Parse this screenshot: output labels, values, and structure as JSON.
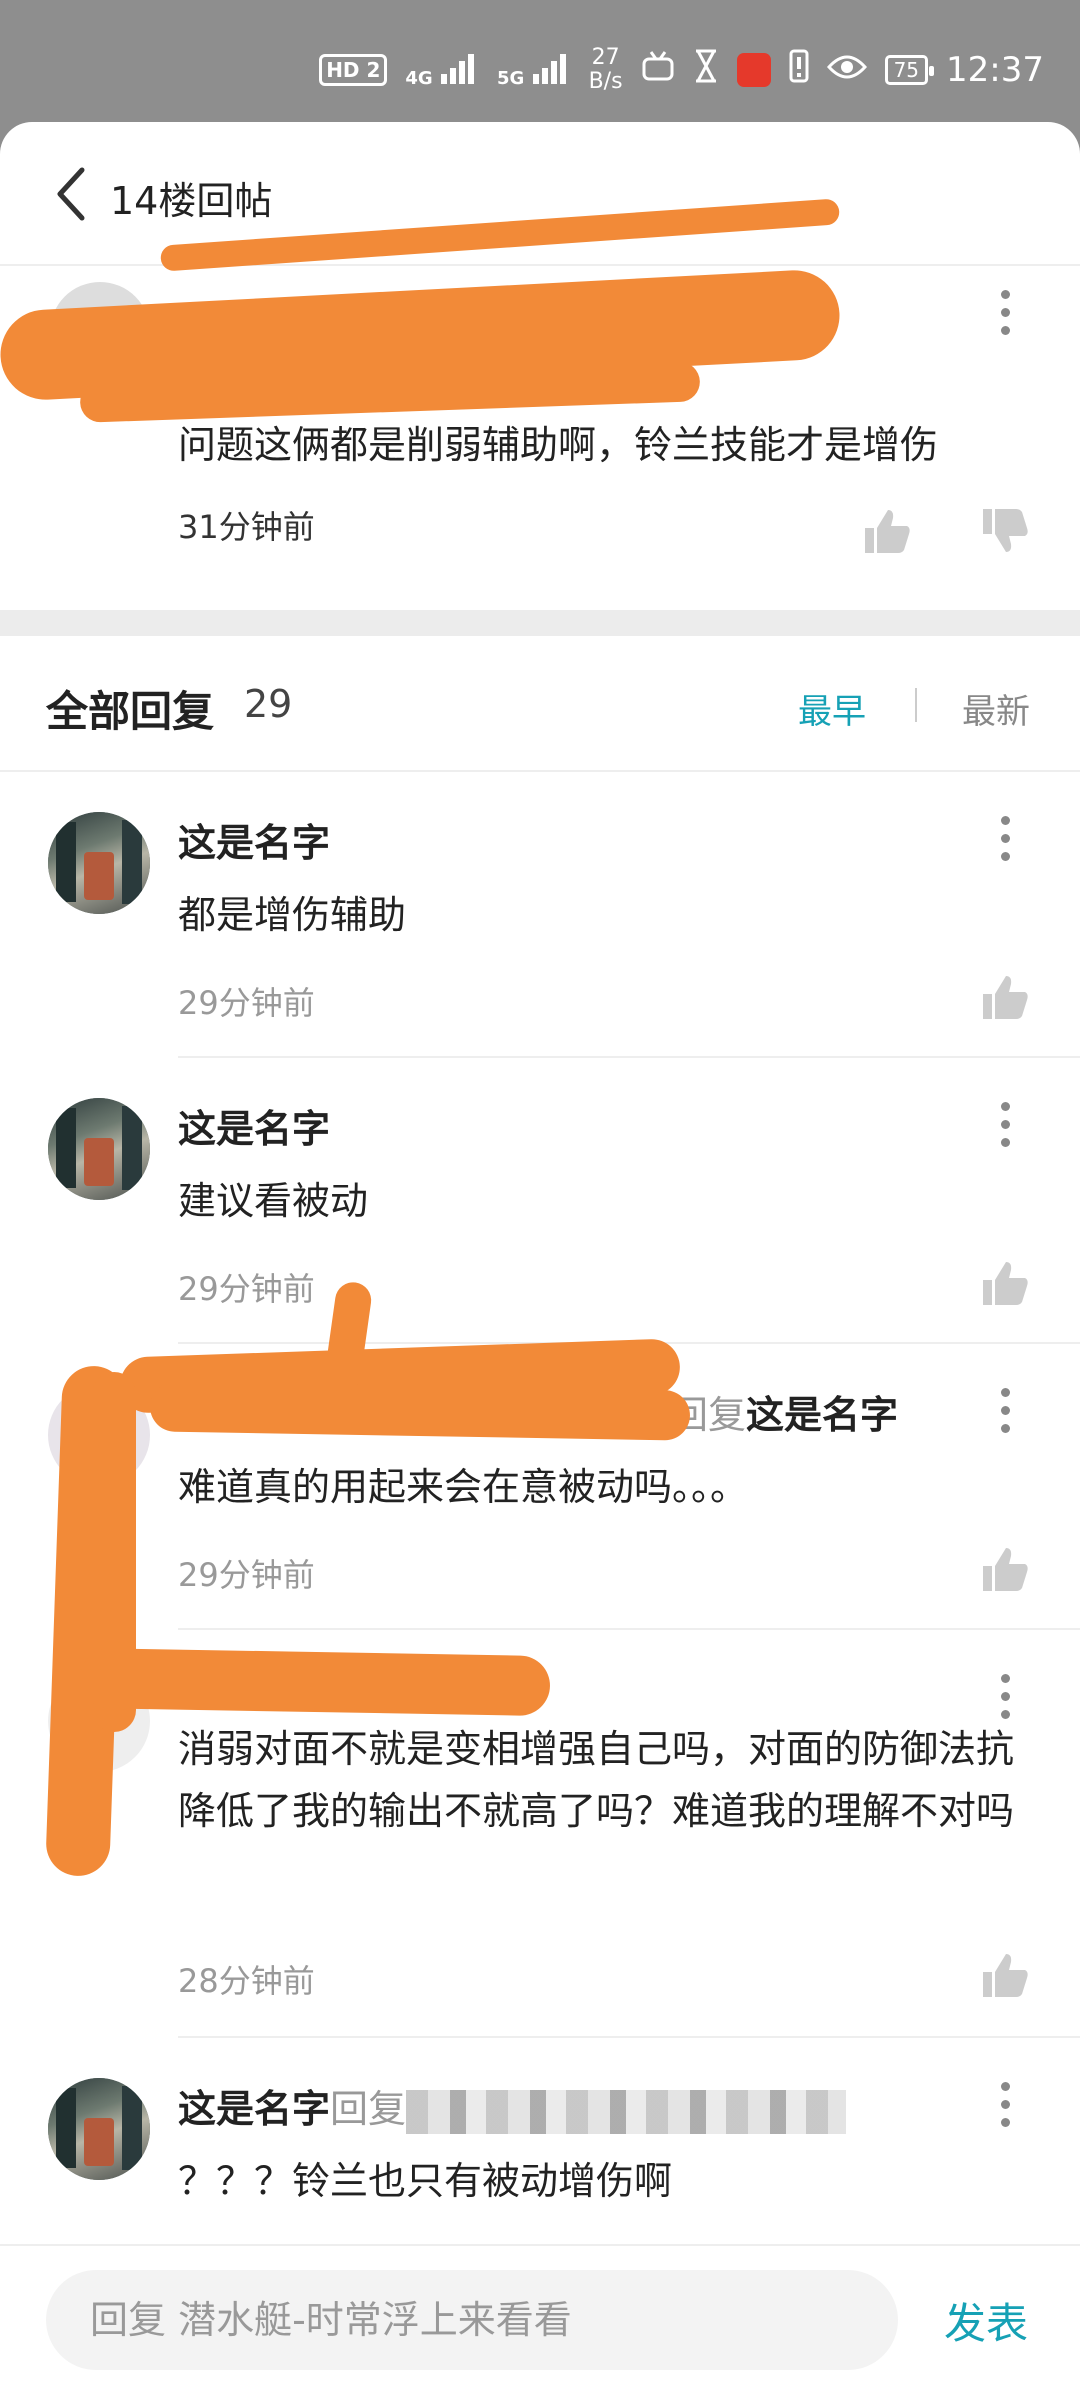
{
  "statusbar": {
    "network_hd": "HD 2",
    "net1": "4G",
    "net2": "5G",
    "speed_value": "27",
    "speed_unit": "B/s",
    "battery": "75",
    "time": "12:37",
    "icons": [
      "hd-icon",
      "signal-4g-icon",
      "signal-5g-icon",
      "tv-icon",
      "hourglass-icon",
      "app-notification-icon",
      "alert-icon",
      "eye-icon",
      "battery-icon"
    ]
  },
  "header": {
    "title": "14楼回帖"
  },
  "original_post": {
    "text": "问题这俩都是削弱辅助啊，铃兰技能才是增伤",
    "time": "31分钟前"
  },
  "all_replies": {
    "title": "全部回复",
    "count": "29",
    "sort_earliest": "最早",
    "sort_latest": "最新"
  },
  "replies": [
    {
      "name": "这是名字",
      "text": "都是增伤辅助",
      "time": "29分钟前"
    },
    {
      "name": "这是名字",
      "text": "建议看被动",
      "time": "29分钟前"
    },
    {
      "reply_label": "回复",
      "target": "这是名字",
      "text": "难道真的用起来会在意被动吗。。。",
      "time": "29分钟前"
    },
    {
      "text": "消弱对面不就是变相增强自己吗，对面的防御法抗降低了我的输出不就高了吗？难道我的理解不对吗",
      "time": "28分钟前"
    },
    {
      "name": "这是名字",
      "reply_label": "回复",
      "text": "？？？铃兰也只有被动增伤啊"
    }
  ],
  "bottom": {
    "placeholder": "回复 潜水艇-时常浮上来看看",
    "send": "发表"
  },
  "colors": {
    "accent": "#16a1b5",
    "scribble": "#f28a38"
  }
}
